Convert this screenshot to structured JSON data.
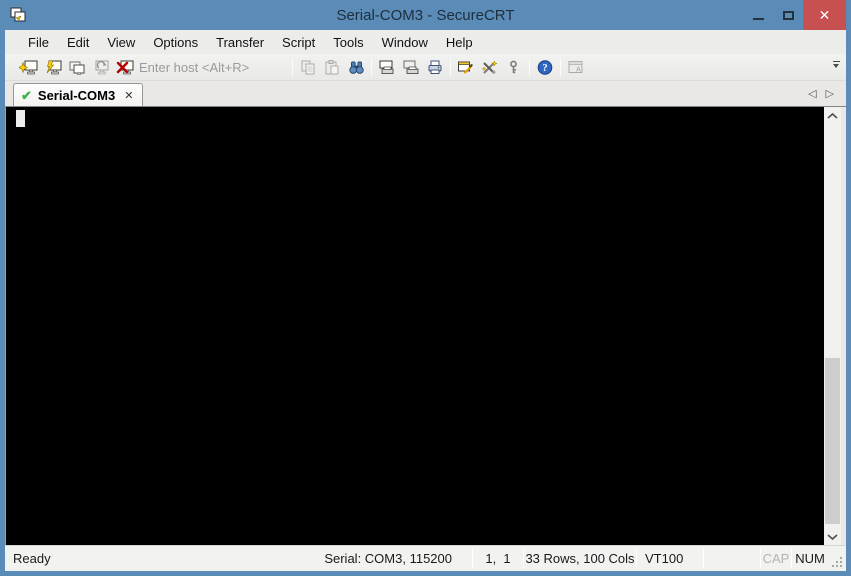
{
  "window": {
    "title": "Serial-COM3 - SecureCRT",
    "controls": {
      "close_glyph": "✕"
    }
  },
  "menu_bar": {
    "items": [
      "File",
      "Edit",
      "View",
      "Options",
      "Transfer",
      "Script",
      "Tools",
      "Window",
      "Help"
    ]
  },
  "toolbar": {
    "host_input": {
      "placeholder": "Enter host <Alt+R>",
      "value": ""
    },
    "buttons": [
      {
        "name": "connect",
        "enabled": true
      },
      {
        "name": "quick-connect",
        "enabled": true
      },
      {
        "name": "connect-in-tab",
        "enabled": true
      },
      {
        "name": "reconnect",
        "enabled": false
      },
      {
        "name": "disconnect",
        "enabled": true
      },
      {
        "name": "copy",
        "enabled": false
      },
      {
        "name": "paste",
        "enabled": false
      },
      {
        "name": "find",
        "enabled": true
      },
      {
        "name": "print-screen",
        "enabled": true
      },
      {
        "name": "auto-print",
        "enabled": true
      },
      {
        "name": "print",
        "enabled": true
      },
      {
        "name": "session-options",
        "enabled": true
      },
      {
        "name": "global-options",
        "enabled": true
      },
      {
        "name": "key-generator",
        "enabled": true
      },
      {
        "name": "help",
        "enabled": true
      },
      {
        "name": "launch-application",
        "enabled": false
      }
    ]
  },
  "tab_bar": {
    "active_tab": {
      "label": "Serial-COM3",
      "status": "connected"
    },
    "glyphs": {
      "connected_check": "✔",
      "close": "✕",
      "scroll_left": "◁",
      "scroll_right": "▷"
    }
  },
  "status_bar": {
    "message": "Ready",
    "connection": "Serial: COM3, 115200",
    "cursor_position": "1,  1",
    "terminal_size": "33 Rows, 100 Cols",
    "emulation": "VT100",
    "caps_lock": "CAP",
    "num_lock": "NUM"
  },
  "colors": {
    "title_bar": "#5b8cb8",
    "close_button": "#c75050",
    "terminal_background": "#000000",
    "connected_green": "#3db24d",
    "toolbar_background": "#eeeeec"
  }
}
